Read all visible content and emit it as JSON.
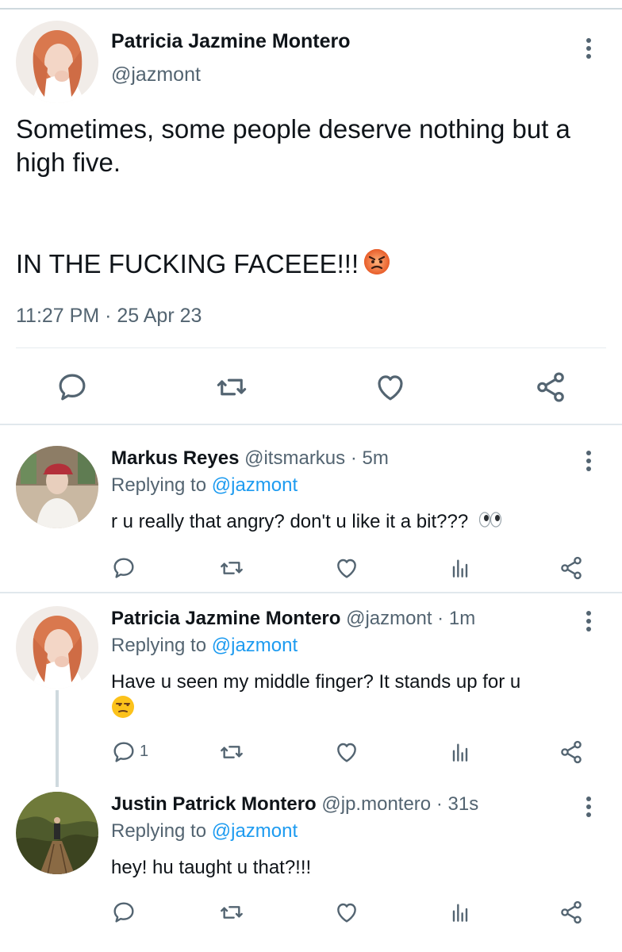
{
  "main_tweet": {
    "author_name": "Patricia Jazmine Montero",
    "author_handle": "@jazmont",
    "text": "Sometimes, some people deserve nothing but a high five.",
    "text_line2": "IN THE FUCKING FACEEE!!!",
    "emoji": "angry-face-emoji",
    "timestamp": "11:27 PM · 25 Apr 23",
    "actions": [
      "reply-icon",
      "retweet-icon",
      "like-icon",
      "share-icon"
    ]
  },
  "replies": [
    {
      "author_name": "Markus Reyes",
      "author_handle": "@itsmarkus",
      "separator": "·",
      "time": "5m",
      "replying_prefix": "Replying to",
      "replying_to": "@jazmont",
      "text": "r u really that angry? don't u like it a bit???",
      "emoji": "eyes-emoji",
      "reply_count": ""
    },
    {
      "author_name": "Patricia Jazmine Montero",
      "author_handle": "@jazmont",
      "separator": "·",
      "time": "1m",
      "replying_prefix": "Replying to",
      "replying_to": "@jazmont",
      "text": "Have u seen my middle finger? It stands up for u",
      "emoji": "unamused-face-emoji",
      "reply_count": "1"
    },
    {
      "author_name": "Justin Patrick Montero",
      "author_handle": "@jp.montero",
      "separator": "·",
      "time": "31s",
      "replying_prefix": "Replying to",
      "replying_to": "@jazmont",
      "text": "hey! hu taught u that?!!!",
      "emoji": "",
      "reply_count": ""
    }
  ],
  "colors": {
    "text_primary": "#0f1419",
    "text_secondary": "#536471",
    "link": "#1d9bf0",
    "divider": "#e1e8ed",
    "icon": "#536471"
  }
}
